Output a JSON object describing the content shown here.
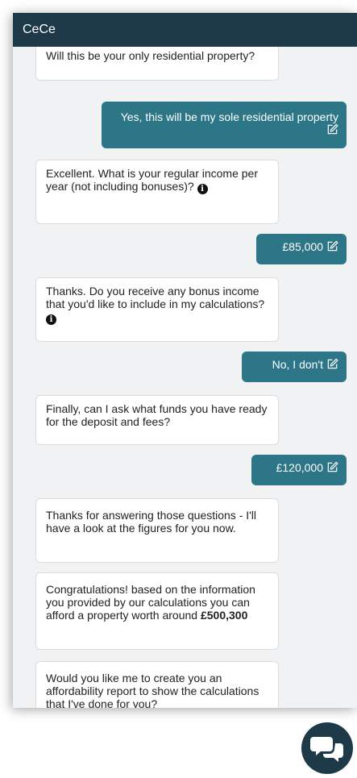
{
  "header": {
    "title": "CeCe"
  },
  "messages": {
    "m1": "Will this be your only residential property?",
    "m2": "Yes, this will be my sole residential property",
    "m3": "Excellent. What is your regular income per year (not including bonuses)?",
    "m4": "£85,000",
    "m5": "Thanks. Do you receive any bonus income that you'd like to include in my calculations?",
    "m6": "No, I don't",
    "m7": "Finally, can I ask what funds you have ready for the deposit and fees?",
    "m8": "£120,000",
    "m9": "Thanks for answering those questions - I'll have a look at the figures for you now.",
    "m10_prefix": "Congratulations! based on the information you provided by our calculations you can afford a property worth around ",
    "m10_amount": "£500,300",
    "m11": "Would you like me to create you an affordability report to show the calculations that I've done for you?"
  },
  "icons": {
    "info_glyph": "i"
  },
  "colors": {
    "header_bg": "#1e3947",
    "user_bubble": "#2c7687",
    "widget_bg": "#f1f2f3",
    "fab_bg": "#1e3947"
  }
}
